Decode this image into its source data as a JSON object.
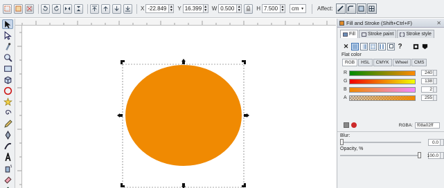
{
  "toolbar": {
    "x_label": "X",
    "x_value": "-22.849",
    "y_label": "Y",
    "y_value": "16.399",
    "w_label": "W",
    "w_value": "0.500",
    "h_label": "H",
    "h_value": "7.500",
    "unit": "cm",
    "affect_label": "Affect:",
    "select_icons": [
      "select-all-icon",
      "select-in-all-layers-icon",
      "deselect-icon",
      "rotate-ccw-icon",
      "rotate-cw-icon",
      "flip-horizontal-icon",
      "flip-vertical-icon",
      "raise-to-top-icon",
      "raise-icon",
      "lower-icon",
      "lower-to-bottom-icon"
    ]
  },
  "tools": [
    "selector-tool-icon",
    "node-tool-icon",
    "tweak-tool-icon",
    "zoom-tool-icon",
    "rectangle-tool-icon",
    "3d-box-tool-icon",
    "ellipse-tool-icon",
    "star-tool-icon",
    "spiral-tool-icon",
    "pencil-tool-icon",
    "pen-tool-icon",
    "calligraphy-tool-icon",
    "text-tool-icon",
    "spray-tool-icon",
    "eraser-tool-icon",
    "paint-bucket-tool-icon"
  ],
  "canvas": {
    "ellipse_fill": "#f08a02"
  },
  "dock": {
    "title": "Fill and Stroke (Shift+Ctrl+F)",
    "tabs": [
      "Fill",
      "Stroke paint",
      "Stroke style"
    ],
    "help_glyph": "?",
    "flat_color_label": "Flat color",
    "mode_tabs": [
      "RGB",
      "HSL",
      "CMYK",
      "Wheel",
      "CMS"
    ],
    "channels": [
      {
        "label": "R",
        "value": "240"
      },
      {
        "label": "G",
        "value": "138"
      },
      {
        "label": "B",
        "value": "2"
      },
      {
        "label": "A",
        "value": "255"
      }
    ],
    "rgba_label": "RGBA:",
    "rgba_value": "f08a02ff",
    "blur_label": "Blur:",
    "blur_value": "0.0",
    "opacity_label": "Opacity, %",
    "opacity_value": "100.0"
  }
}
